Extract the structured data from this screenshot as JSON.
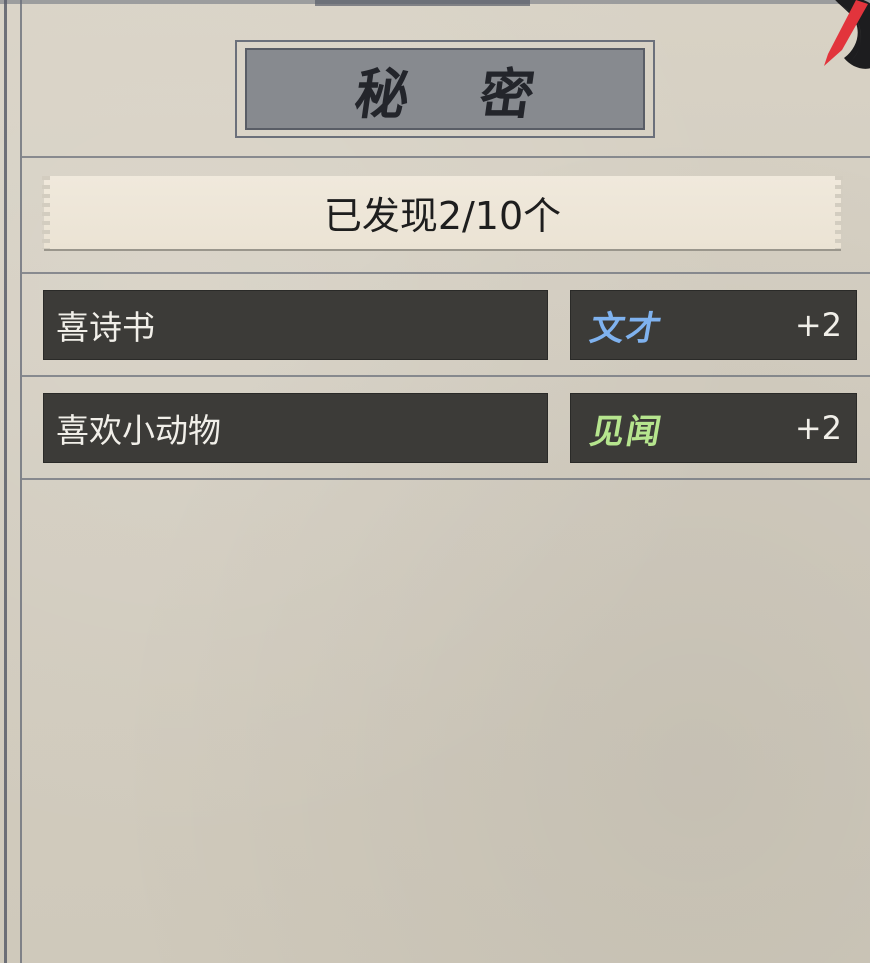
{
  "title": "秘 密",
  "discovered": "已发现2/10个",
  "secrets": [
    {
      "name": "喜诗书",
      "attribute": "文才",
      "attribute_color": "#7fb2ef",
      "bonus": "+2"
    },
    {
      "name": "喜欢小动物",
      "attribute": "见闻",
      "attribute_color": "#b6e58e",
      "bonus": "+2"
    }
  ],
  "colors": {
    "paper": "#d3cdc0",
    "plaque": "#878a8f",
    "row_bg": "#3c3b38",
    "banner": "#ede5d6",
    "corner_accent": "#e2343c"
  },
  "icons": {
    "corner": "close-icon"
  }
}
